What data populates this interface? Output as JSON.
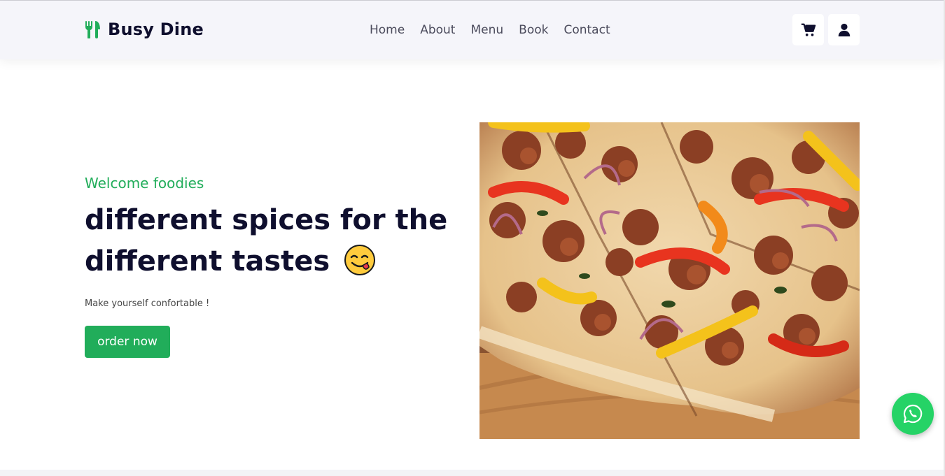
{
  "brand": {
    "name": "Busy Dine",
    "icon": "utensils-icon",
    "color": "#21ad5a"
  },
  "nav": {
    "items": [
      {
        "label": "Home"
      },
      {
        "label": "About"
      },
      {
        "label": "Menu"
      },
      {
        "label": "Book"
      },
      {
        "label": "Contact"
      }
    ]
  },
  "header_icons": [
    {
      "icon": "shopping-cart-icon"
    },
    {
      "icon": "user-icon"
    }
  ],
  "hero": {
    "eyebrow": "Welcome foodies",
    "headline_line1": "different spices for the",
    "headline_line2": "different tastes",
    "emoji": "face-savoring-food-emoji",
    "subtext": "Make yourself confortable !",
    "cta_label": "order now",
    "image": "pizza-photo"
  },
  "floating": {
    "icon": "whatsapp-icon",
    "color": "#25d366"
  },
  "colors": {
    "accent": "#21ad5a",
    "heading": "#0f0f2e",
    "navbar_bg": "#f5f5fa"
  }
}
